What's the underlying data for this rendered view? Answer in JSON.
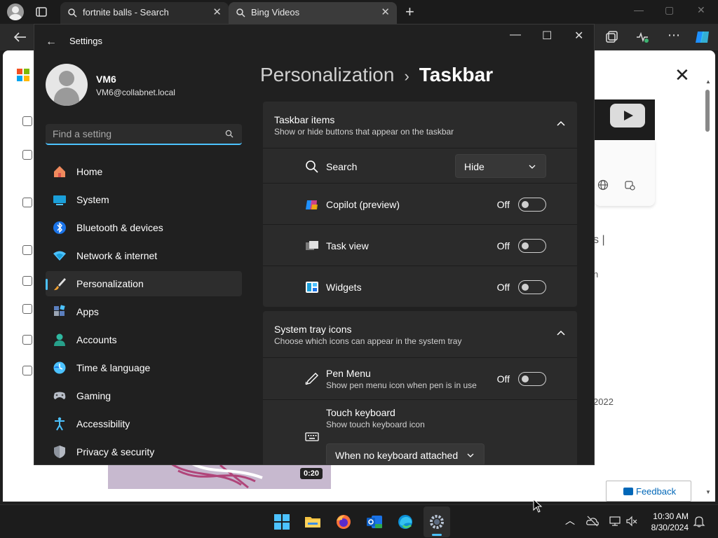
{
  "browser": {
    "tabs": [
      {
        "label": "fortnite balls - Search",
        "close": "✕"
      },
      {
        "label": "Bing Videos",
        "close": "✕"
      }
    ],
    "new_tab": "+",
    "window_controls": {
      "minimize": "—",
      "maximize": "▢",
      "close": "✕"
    }
  },
  "webpage": {
    "partial_text_1": "s |",
    "partial_text_2": "n",
    "partial_text_3": "2022",
    "video_duration": "0:20",
    "feedback_label": "Feedback",
    "close_glyph": "✕"
  },
  "settings": {
    "title": "Settings",
    "back_glyph": "←",
    "window_controls": {
      "minimize": "—",
      "maximize": "☐",
      "close": "✕"
    },
    "user": {
      "name": "VM6",
      "email": "VM6@collabnet.local"
    },
    "search": {
      "placeholder": "Find a setting"
    },
    "nav": [
      {
        "label": "Home",
        "icon": "home-icon"
      },
      {
        "label": "System",
        "icon": "system-icon"
      },
      {
        "label": "Bluetooth & devices",
        "icon": "bluetooth-icon"
      },
      {
        "label": "Network & internet",
        "icon": "network-icon"
      },
      {
        "label": "Personalization",
        "icon": "paintbrush-icon",
        "active": true
      },
      {
        "label": "Apps",
        "icon": "apps-icon"
      },
      {
        "label": "Accounts",
        "icon": "accounts-icon"
      },
      {
        "label": "Time & language",
        "icon": "clock-globe-icon"
      },
      {
        "label": "Gaming",
        "icon": "gamepad-icon"
      },
      {
        "label": "Accessibility",
        "icon": "accessibility-icon"
      },
      {
        "label": "Privacy & security",
        "icon": "shield-icon"
      }
    ],
    "breadcrumb": {
      "parent": "Personalization",
      "separator": "›",
      "current": "Taskbar"
    },
    "taskbar_items": {
      "title": "Taskbar items",
      "subtitle": "Show or hide buttons that appear on the taskbar",
      "rows": [
        {
          "label": "Search",
          "control": "dropdown",
          "value": "Hide"
        },
        {
          "label": "Copilot (preview)",
          "control": "toggle",
          "state": "Off"
        },
        {
          "label": "Task view",
          "control": "toggle",
          "state": "Off"
        },
        {
          "label": "Widgets",
          "control": "toggle",
          "state": "Off"
        }
      ]
    },
    "system_tray": {
      "title": "System tray icons",
      "subtitle": "Choose which icons can appear in the system tray",
      "rows": [
        {
          "label": "Pen Menu",
          "sub": "Show pen menu icon when pen is in use",
          "control": "toggle",
          "state": "Off"
        },
        {
          "label": "Touch keyboard",
          "sub": "Show touch keyboard icon",
          "control": "dropdown",
          "value": "When no keyboard attached"
        }
      ]
    }
  },
  "taskbar": {
    "time": "10:30 AM",
    "date": "8/30/2024"
  },
  "colors": {
    "accent": "#4cc2ff",
    "settings_bg": "#202020",
    "card_bg": "#2b2b2b",
    "taskbar_bg": "#1c1c1c"
  }
}
